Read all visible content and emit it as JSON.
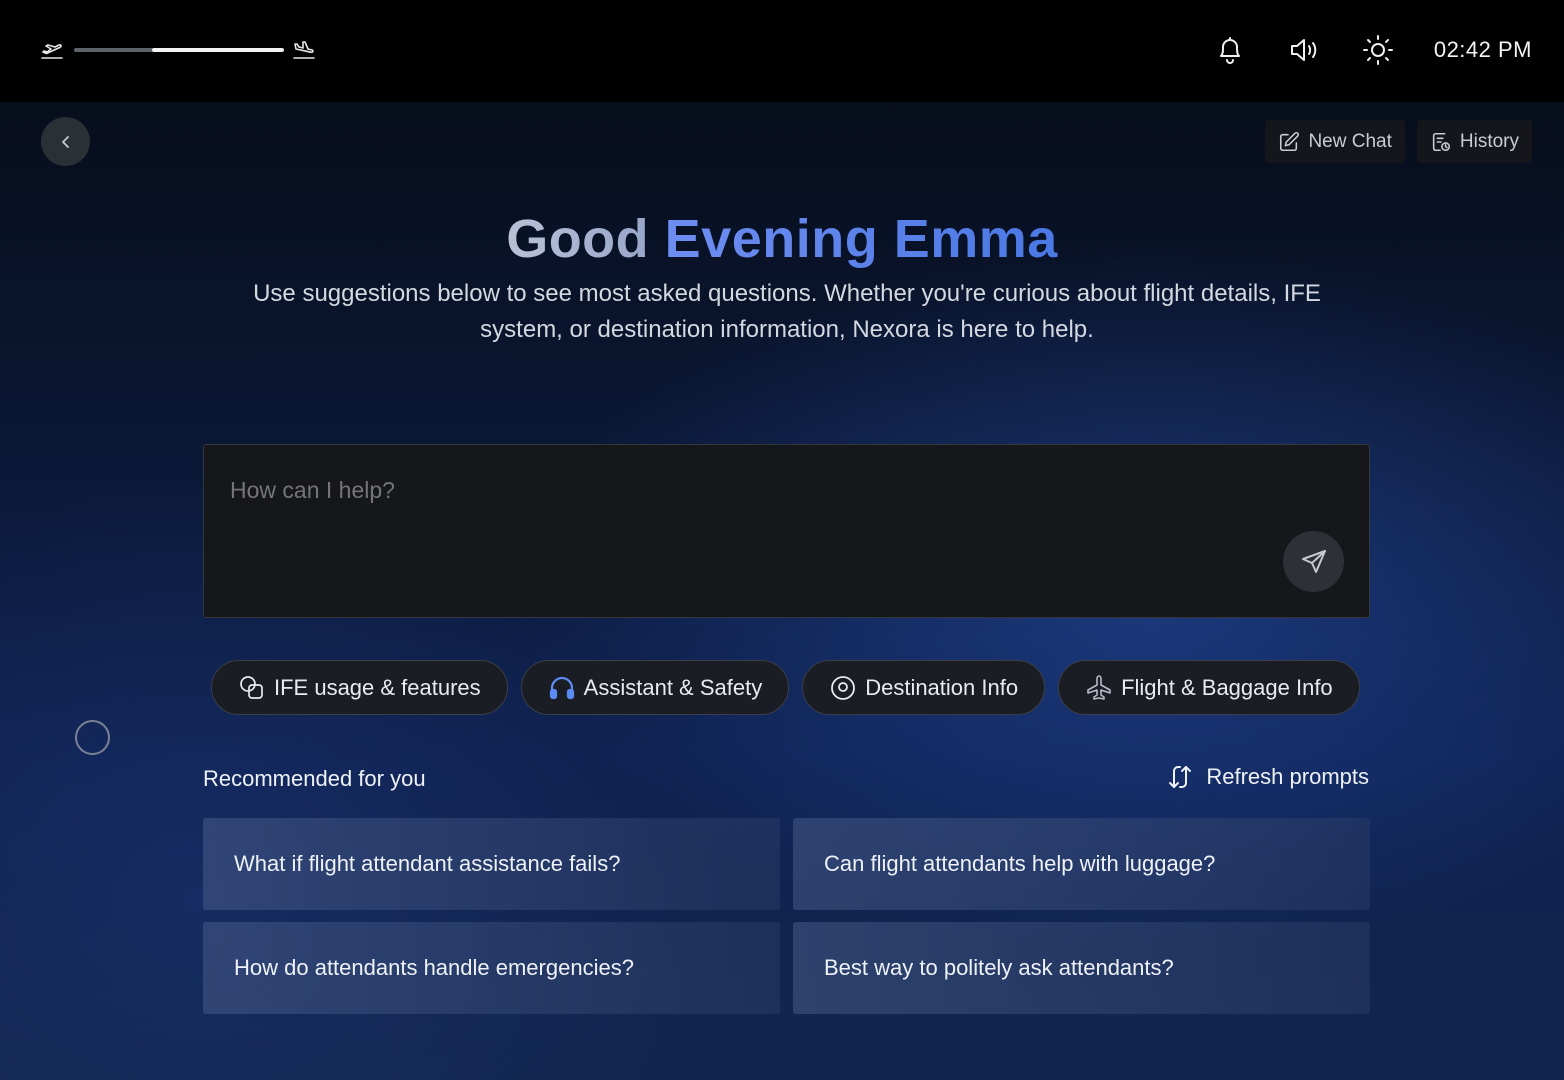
{
  "status_bar": {
    "flight_progress": 0.55,
    "flight_elapsed": 0.37,
    "departure_icon": "plane-takeoff-icon",
    "arrival_icon": "plane-landing-icon",
    "icons": [
      "bell-icon",
      "volume-icon",
      "brightness-icon"
    ],
    "time": "02:42 PM"
  },
  "header": {
    "back_icon": "chevron-left-icon",
    "new_chat_label": "New Chat",
    "history_label": "History"
  },
  "greeting": {
    "prefix": "Good",
    "name_part": "Evening Emma",
    "subtitle": "Use suggestions below to see most asked questions. Whether you're curious about flight details, IFE system, or destination information, Nexora is here to help."
  },
  "prompt": {
    "placeholder": "How can I help?",
    "value": ""
  },
  "categories": [
    {
      "label": "IFE usage & features",
      "icon": "overlapping-shapes-icon"
    },
    {
      "label": "Assistant & Safety",
      "icon": "headset-icon"
    },
    {
      "label": "Destination Info",
      "icon": "location-pin-icon"
    },
    {
      "label": "Flight & Baggage Info",
      "icon": "airplane-icon"
    }
  ],
  "recommended": {
    "title": "Recommended for you",
    "refresh_label": "Refresh prompts",
    "items": [
      "What if flight attendant assistance fails?",
      "Can flight attendants help with luggage?",
      "How do attendants handle emergencies?",
      "Best way to politely ask attendants?"
    ]
  },
  "colors": {
    "accent_blue": "#4a78e4",
    "background_top": "#060a14",
    "background_bottom": "#11264f"
  }
}
